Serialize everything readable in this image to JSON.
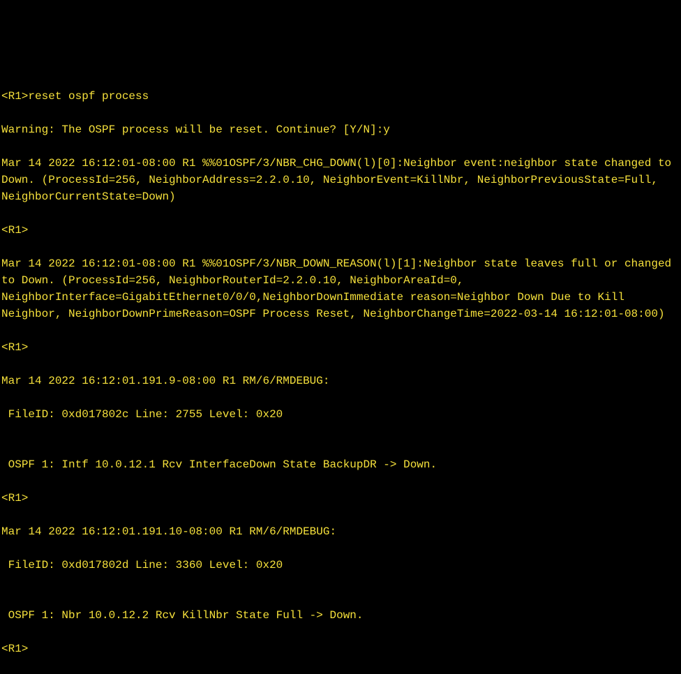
{
  "terminal": {
    "lines": [
      "<R1>reset ospf process",
      "Warning: The OSPF process will be reset. Continue? [Y/N]:y",
      "Mar 14 2022 16:12:01-08:00 R1 %%01OSPF/3/NBR_CHG_DOWN(l)[0]:Neighbor event:neighbor state changed to Down. (ProcessId=256, NeighborAddress=2.2.0.10, NeighborEvent=KillNbr, NeighborPreviousState=Full, NeighborCurrentState=Down)",
      "<R1>",
      "Mar 14 2022 16:12:01-08:00 R1 %%01OSPF/3/NBR_DOWN_REASON(l)[1]:Neighbor state leaves full or changed to Down. (ProcessId=256, NeighborRouterId=2.2.0.10, NeighborAreaId=0, NeighborInterface=GigabitEthernet0/0/0,NeighborDownImmediate reason=Neighbor Down Due to Kill Neighbor, NeighborDownPrimeReason=OSPF Process Reset, NeighborChangeTime=2022-03-14 16:12:01-08:00)",
      "<R1>",
      "Mar 14 2022 16:12:01.191.9-08:00 R1 RM/6/RMDEBUG:",
      " FileID: 0xd017802c Line: 2755 Level: 0x20",
      "",
      " OSPF 1: Intf 10.0.12.1 Rcv InterfaceDown State BackupDR -> Down.",
      "<R1>",
      "Mar 14 2022 16:12:01.191.10-08:00 R1 RM/6/RMDEBUG:",
      " FileID: 0xd017802d Line: 3360 Level: 0x20",
      "",
      " OSPF 1: Nbr 10.0.12.2 Rcv KillNbr State Full -> Down.",
      "<R1>"
    ]
  }
}
